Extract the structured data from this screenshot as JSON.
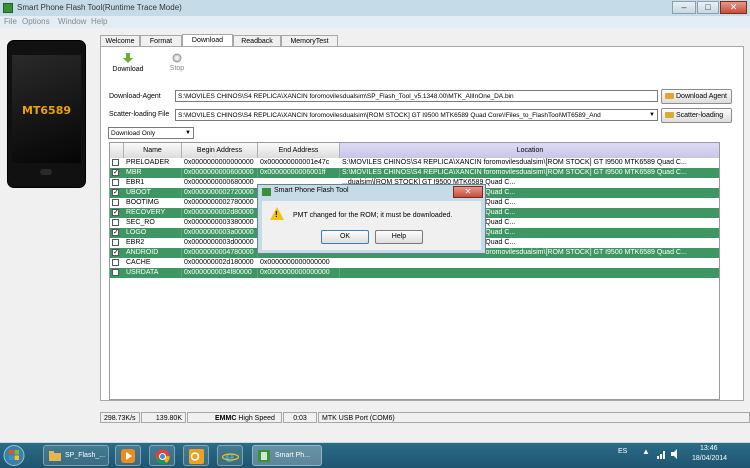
{
  "window": {
    "title": "Smart Phone Flash Tool(Runtime Trace Mode)",
    "controls": {
      "minimize": "–",
      "maximize": "□",
      "close": "✕"
    }
  },
  "menu": [
    "File",
    "Options",
    "Window",
    "Help"
  ],
  "phone": {
    "chip_label": "MT6589"
  },
  "tabs": [
    "Welcome",
    "Format",
    "Download",
    "Readback",
    "MemoryTest"
  ],
  "active_tab": "Download",
  "toolbar": {
    "download_label": "Download",
    "stop_label": "Stop"
  },
  "download_agent": {
    "label": "Download-Agent",
    "value": "S:\\MOVILES CHINOS\\S4 REPLICA\\XANCIN foromovilesdualsim\\SP_Flash_Tool_v5.1348.00\\MTK_AllInOne_DA.bin",
    "button": "Download Agent"
  },
  "scatter": {
    "label": "Scatter-loading File",
    "value": "S:\\MOVILES CHINOS\\S4 REPLICA\\XANCIN foromovilesdualsim\\[ROM STOCK] GT I9500 MTK6589 Quad Core\\!Files_to_FlashTool\\MT6589_And",
    "button": "Scatter-loading"
  },
  "mode": {
    "selected": "Download Only"
  },
  "table": {
    "headers": [
      "Name",
      "Begin Address",
      "End Address",
      "Location"
    ],
    "rows": [
      {
        "checked": false,
        "green": false,
        "name": "PRELOADER",
        "begin": "0x0000000000000000",
        "end": "0x000000000001e47c",
        "location": "S:\\MOVILES CHINOS\\S4 REPLICA\\XANCIN foromovilesdualsim\\[ROM STOCK] GT I9500 MTK6589 Quad C..."
      },
      {
        "checked": true,
        "green": true,
        "name": "MBR",
        "begin": "0x0000000000600000",
        "end": "0x00000000006001ff",
        "location": "S:\\MOVILES CHINOS\\S4 REPLICA\\XANCIN foromovilesdualsim\\[ROM STOCK] GT I9500 MTK6589 Quad C..."
      },
      {
        "checked": false,
        "green": false,
        "name": "EBR1",
        "begin": "0x0000000000680000",
        "end": "",
        "location": "...dualsim\\[ROM STOCK] GT I9500 MTK6589 Quad C..."
      },
      {
        "checked": true,
        "green": true,
        "name": "UBOOT",
        "begin": "0x0000000002720000",
        "end": "",
        "location": "...dualsim\\[ROM STOCK] GT I9500 MTK6589 Quad C..."
      },
      {
        "checked": false,
        "green": false,
        "name": "BOOTIMG",
        "begin": "0x0000000002780000",
        "end": "",
        "location": "...dualsim\\[ROM STOCK] GT I9500 MTK6589 Quad C..."
      },
      {
        "checked": true,
        "green": true,
        "name": "RECOVERY",
        "begin": "0x0000000002d80000",
        "end": "",
        "location": "...dualsim\\[ROM STOCK] GT I9500 MTK6589 Quad C..."
      },
      {
        "checked": false,
        "green": false,
        "name": "SEC_RO",
        "begin": "0x0000000003380000",
        "end": "",
        "location": "...dualsim\\[ROM STOCK] GT I9500 MTK6589 Quad C..."
      },
      {
        "checked": true,
        "green": true,
        "name": "LOGO",
        "begin": "0x0000000003a00000",
        "end": "",
        "location": "...dualsim\\[ROM STOCK] GT I9500 MTK6589 Quad C..."
      },
      {
        "checked": false,
        "green": false,
        "name": "EBR2",
        "begin": "0x0000000003d00000",
        "end": "",
        "location": "...dualsim\\[ROM STOCK] GT I9500 MTK6589 Quad C..."
      },
      {
        "checked": true,
        "green": true,
        "name": "ANDROID",
        "begin": "0x0000000004780000",
        "end": "",
        "location": "S:\\MOVILES CHINOS\\S4 REPLICA\\XANCIN foromovilesdualsim\\[ROM STOCK] GT I9500 MTK6589 Quad C..."
      },
      {
        "checked": false,
        "green": false,
        "name": "CACHE",
        "begin": "0x000000002d180000",
        "end": "0x0000000000000000",
        "location": ""
      },
      {
        "checked": false,
        "green": true,
        "name": "USRDATA",
        "begin": "0x0000000034f80000",
        "end": "0x0000000000000000",
        "location": ""
      }
    ]
  },
  "dialog": {
    "title": "Smart Phone Flash Tool",
    "message": "PMT changed for the ROM; it must be downloaded.",
    "ok": "OK",
    "help": "Help",
    "close": "✕"
  },
  "status": {
    "speed": "298.73K/s",
    "size": "139.80K",
    "storage": "EMMC",
    "speed_mode": "High Speed",
    "time": "0:03",
    "port": "MTK USB Port (COM6)"
  },
  "taskbar": {
    "apps": [
      {
        "label": "SP_Flash_...",
        "active": false
      },
      {
        "label": "Smart Ph...",
        "active": true
      }
    ],
    "lang": "ES",
    "time": "13:46",
    "date": "18/04/2014"
  },
  "colors": {
    "accent_green": "#3e9662",
    "header_purple": "#c8c6e8",
    "warning_yellow": "#f5c400"
  }
}
